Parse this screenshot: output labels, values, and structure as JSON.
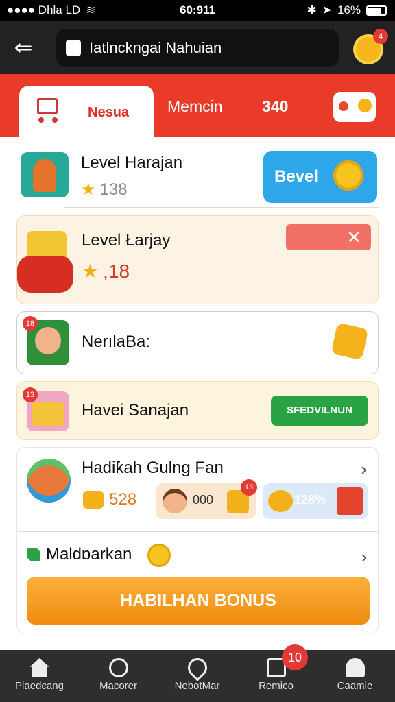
{
  "status_bar": {
    "carrier": "●●●● Dhla LD",
    "time": "60:911",
    "battery": "16%"
  },
  "app_bar": {
    "title": "Iatlnckngai Nahuian",
    "notification_count": "4"
  },
  "tabs": {
    "active": "Nesua",
    "second": "Memcin",
    "third": "340"
  },
  "rows": {
    "r1": {
      "title": "Level Harajan",
      "rating": "138",
      "button": "Bevel"
    },
    "r2": {
      "title": "Level Łarjay",
      "rating": ",18"
    },
    "r3": {
      "title": "NerılaBa:",
      "badge": "18"
    },
    "r4": {
      "title": "Havei Sanajan",
      "badge": "13",
      "button": "SFEDVILNUN"
    },
    "r5": {
      "title": "Hadiƙah Gulng Fan",
      "coins": "528",
      "pill_a_value": "000",
      "pill_a_badge": "13",
      "pill_b_value": "128%",
      "subtitle": "Maldɒarkan",
      "bonus_button": "HABILHAN BONUS"
    }
  },
  "bottom_nav": [
    {
      "label": "Plaedcang"
    },
    {
      "label": "Macorer"
    },
    {
      "label": "NebotMar"
    },
    {
      "label": "Remico",
      "badge": "10"
    },
    {
      "label": "Caamle"
    }
  ],
  "colors": {
    "accent_red": "#ea3b2a",
    "blue": "#2ea6ea",
    "green": "#2aa345",
    "orange": "#f59a1c"
  }
}
